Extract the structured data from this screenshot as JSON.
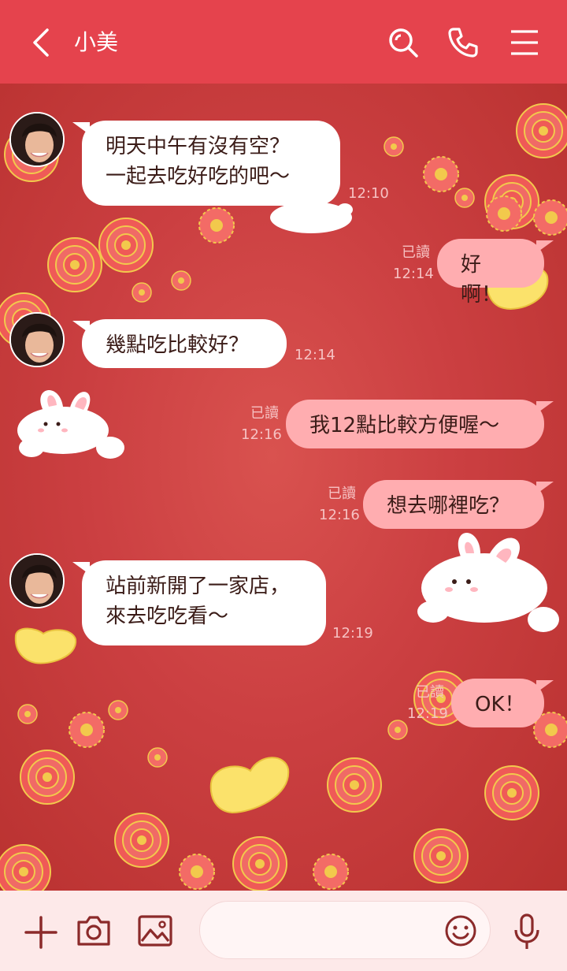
{
  "header": {
    "title": "小美"
  },
  "messages": [
    {
      "id": "m1",
      "side": "in",
      "lines": [
        "明天中午有沒有空？",
        "一起去吃好吃的吧～"
      ],
      "time": "12:10"
    },
    {
      "id": "m2",
      "side": "out",
      "lines": [
        "好啊！"
      ],
      "read": "已讀",
      "time": "12:14"
    },
    {
      "id": "m3",
      "side": "in",
      "lines": [
        "幾點吃比較好？"
      ],
      "time": "12:14"
    },
    {
      "id": "m4",
      "side": "out",
      "lines": [
        "我12點比較方便喔～"
      ],
      "read": "已讀",
      "time": "12:16"
    },
    {
      "id": "m5",
      "side": "out",
      "lines": [
        "想去哪裡吃？"
      ],
      "read": "已讀",
      "time": "12:16"
    },
    {
      "id": "m6",
      "side": "in",
      "lines": [
        "站前新開了一家店，",
        "來去吃吃看～"
      ],
      "time": "12:19"
    },
    {
      "id": "m7",
      "side": "out",
      "lines": [
        "OK！"
      ],
      "read": "已讀",
      "time": "12:19"
    }
  ],
  "icons": {
    "back": "chevron-left-icon",
    "search": "search-icon",
    "call": "phone-icon",
    "menu": "menu-icon",
    "plus": "plus-icon",
    "camera": "camera-icon",
    "image": "image-icon",
    "emoji": "emoji-icon",
    "mic": "microphone-icon"
  },
  "colors": {
    "header": "#e5434d",
    "chat_bg": "#c93a3d",
    "incoming": "#ffffff",
    "outgoing": "#ffadb0",
    "footer": "#fde9e9",
    "icon": "#8b2a2a"
  }
}
